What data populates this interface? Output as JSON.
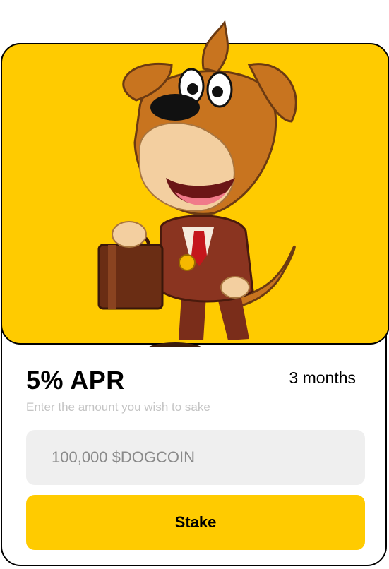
{
  "staking_card": {
    "apr_label": "5% APR",
    "duration": "3 months",
    "hint": "Enter the amount you wish to sake",
    "amount_placeholder": "100,000 $DOGCOIN",
    "stake_label": "Stake"
  },
  "colors": {
    "accent": "#FFCB00",
    "input_bg": "#EFEFEF",
    "hint_text": "#C4C4C4"
  },
  "icons": [
    "dog-mascot-illustration"
  ]
}
